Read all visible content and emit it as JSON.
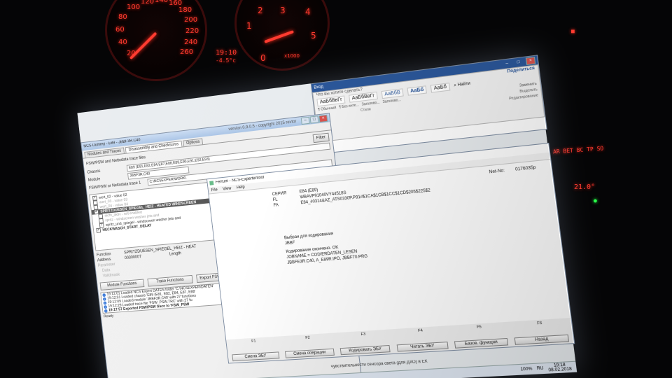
{
  "dashboard": {
    "speedo_ticks": [
      "20",
      "40",
      "60",
      "80",
      "100",
      "120",
      "140",
      "160",
      "180",
      "200",
      "220",
      "240",
      "260"
    ],
    "tacho_ticks": [
      "0",
      "1",
      "2",
      "3",
      "4",
      "5"
    ],
    "time_temp": "19:10",
    "outside_temp": "-4.5°c",
    "tacho_unit": "x1000",
    "climate_temp": "21.0°",
    "right_display": "AR BET BC TP SO"
  },
  "ncs": {
    "title": "NCS Dummy - E89 - JBBF3R.C40",
    "version": "version 0.9.0.5 - copyright 2015 revtor",
    "tabs": [
      "Modules and Traces",
      "Disassembly and Checksums",
      "Options"
    ],
    "trace_label": "FSW/PSW and Nettodata trace files",
    "filter_label": "Filter",
    "chassis_label": "Chassis",
    "chassis_value": "E89 (E81,E82,E84,E87,E88,E89,E90,E91,E92,E93)",
    "module_label": "Module",
    "module_value": "JBBF3R.C40",
    "trace1_label": "FSW/PSW or Nettodata trace 1",
    "trace1_value": "C:\\NCSEXPER\\WORK\\",
    "checks": [
      {
        "label": "wert_02 - value 02",
        "checked": true,
        "bold": false
      },
      {
        "label": "wert_03 - value 03",
        "checked": false,
        "bold": false
      },
      {
        "label": "wert_04 - value 04",
        "checked": false,
        "bold": false
      },
      {
        "label": "SPRITZDUESEN_SPIEGEL_HEIZ - HEATED WINDSCREEN",
        "checked": true,
        "bold": true
      },
      {
        "label": "nicht_aktiv - not enabled",
        "checked": false,
        "bold": false
      },
      {
        "label": "spritz - windscreen washer jets and",
        "checked": false,
        "bold": false
      },
      {
        "label": "spritz_und_spiegel - windscreen washer jets and",
        "checked": true,
        "bold": false
      },
      {
        "label": "HECKWASCH_START_DELAY",
        "checked": true,
        "bold": true
      }
    ],
    "function_label": "Function",
    "function_value": "SPRITZDUESEN_SPIEGEL_HEIZ - HEAT",
    "address_label": "Address",
    "address_value": "00300007",
    "length_label": "Length",
    "parameter_label": "Parameter",
    "data_label": "Data",
    "validmask_label": "Validmask",
    "buttons": [
      "Module Functions",
      "Trace Functions",
      "Export FSW/PSW Trace"
    ],
    "log": [
      "19:12:01 Loaded NCS Expert DATEN folder 'C:\\NCSEXPER\\DATEN'",
      "19:12:01 Loaded chassis 'E89 (E81, E82, E84, E87, E88'",
      "19:12:09 Loaded module 'JBBF3R.C40' with 27 functions",
      "19:12:29 Loaded trace file 'FSW_PSW.TRC' with 27 fu",
      "19:17:57 Exported FSW/PSW trace to 'FSW_PSW"
    ],
    "status": "Ready"
  },
  "word": {
    "signin": "Вход",
    "share": "Поделиться",
    "ask": "Что вы хотите сделать?",
    "styles": [
      "АаБбВвГг",
      "АаБбВвГг",
      "АаБбВ",
      "АаБб",
      "АаБб"
    ],
    "style_names": [
      "¶ Обычный",
      "¶ Без инте...",
      "Заголово...",
      "Заголово..."
    ],
    "styles_group": "Стили",
    "find": "Найти",
    "replace": "Заменить",
    "select": "Выделить",
    "editing_group": "Редактирование"
  },
  "ferrum": {
    "title": "Ferrum - NCS-Expertentool",
    "menu": [
      "File",
      "View",
      "Help"
    ],
    "fields": [
      {
        "label": "СЕРИЯ",
        "value": "E84 (E89)"
      },
      {
        "label": "FL",
        "value": "WBAVP91040VY44518S"
      },
      {
        "label": "FA",
        "value": "E84_#0314&AZ_ATS0330P.P91#$1CA$1CB$1CC$1CD$205$225$2"
      }
    ],
    "netno_label": "Net-No:",
    "netno_value": "0176035p",
    "log_lines": [
      "Выбран для кодирования",
      "JBBF",
      "Кодирование окончено. OK",
      "JOBNAME = CODIERDATEN_LESEN",
      "JBBFE3R.C40, A_E89R.IPO, JBBF70.PRG"
    ],
    "fkeys": [
      {
        "num": "F1",
        "label": "Смена ЭБУ"
      },
      {
        "num": "F2",
        "label": "Смена операции"
      },
      {
        "num": "F3",
        "label": "Кодировать ЭБУ"
      },
      {
        "num": "F4",
        "label": "Читать ЭБУ"
      },
      {
        "num": "F5",
        "label": "Базов. функции"
      },
      {
        "num": "F6",
        "label": "Назад"
      }
    ]
  },
  "taskbar": {
    "lang": "RU",
    "time": "19:18",
    "date": "08.02.2018",
    "zoom": "100%"
  },
  "background_doc_text": "чувствительности сенсора света (для ДХО) в ЕК"
}
